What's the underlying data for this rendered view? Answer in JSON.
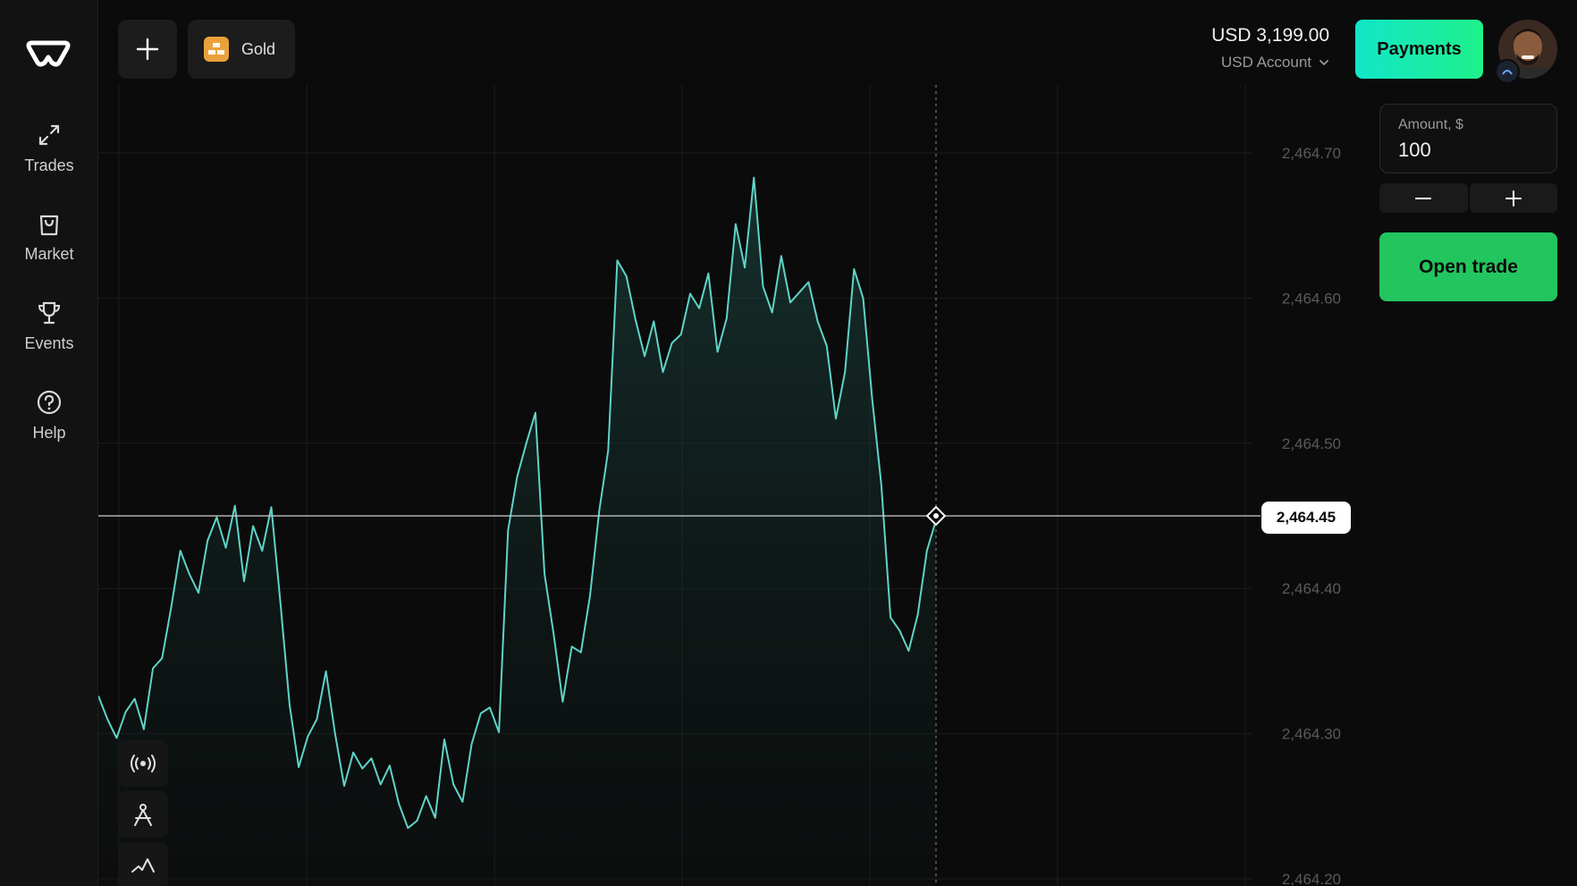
{
  "sidebar": {
    "items": [
      {
        "label": "Trades"
      },
      {
        "label": "Market"
      },
      {
        "label": "Events"
      },
      {
        "label": "Help"
      }
    ]
  },
  "header": {
    "asset_label": "Gold",
    "balance": "USD 3,199.00",
    "account": "USD Account",
    "payments_label": "Payments"
  },
  "trade_panel": {
    "amount_label": "Amount, $",
    "amount_value": "100",
    "open_trade_label": "Open trade"
  },
  "colors": {
    "accent_line": "#5fd3c8",
    "payments_start": "#12e6c8",
    "payments_end": "#1ef08a",
    "open_trade": "#22c55e"
  },
  "chart_data": {
    "type": "area",
    "title": "",
    "xlabel": "",
    "ylabel": "",
    "ylim": [
      2464.2,
      2464.75
    ],
    "y_ticks": [
      "2,464.70",
      "2,464.60",
      "2,464.50",
      "2,464.40",
      "2,464.30",
      "2,464.20"
    ],
    "current_price": "2,464.45",
    "grid": true,
    "series": [
      {
        "values": [
          2464.326,
          2464.31,
          2464.297,
          2464.315,
          2464.324,
          2464.303,
          2464.345,
          2464.352,
          2464.387,
          2464.426,
          2464.41,
          2464.397,
          2464.433,
          2464.449,
          2464.428,
          2464.457,
          2464.405,
          2464.443,
          2464.426,
          2464.456,
          2464.39,
          2464.32,
          2464.277,
          2464.298,
          2464.31,
          2464.343,
          2464.3,
          2464.264,
          2464.287,
          2464.276,
          2464.283,
          2464.265,
          2464.278,
          2464.252,
          2464.235,
          2464.24,
          2464.257,
          2464.242,
          2464.296,
          2464.265,
          2464.253,
          2464.293,
          2464.314,
          2464.318,
          2464.301,
          2464.44,
          2464.477,
          2464.5,
          2464.521,
          2464.41,
          2464.369,
          2464.322,
          2464.36,
          2464.356,
          2464.395,
          2464.453,
          2464.495,
          2464.626,
          2464.615,
          2464.585,
          2464.56,
          2464.584,
          2464.549,
          2464.569,
          2464.575,
          2464.603,
          2464.593,
          2464.617,
          2464.563,
          2464.586,
          2464.651,
          2464.621,
          2464.683,
          2464.608,
          2464.59,
          2464.629,
          2464.597,
          2464.604,
          2464.611,
          2464.584,
          2464.567,
          2464.517,
          2464.549,
          2464.62,
          2464.6,
          2464.53,
          2464.471,
          2464.38,
          2464.371,
          2464.357,
          2464.382,
          2464.426,
          2464.447
        ],
        "range": "2,464.20 – 2,464.75"
      }
    ]
  }
}
